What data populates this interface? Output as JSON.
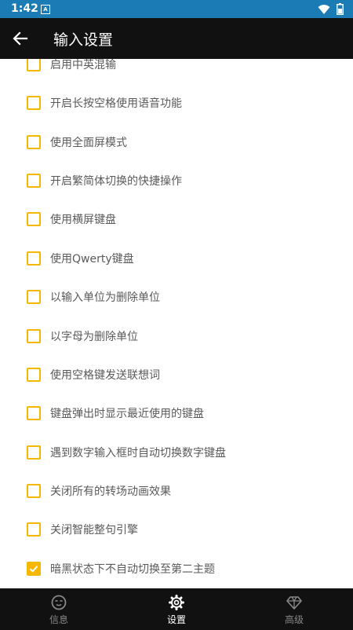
{
  "status_bar": {
    "time": "1:42",
    "app_icon": "A",
    "icons": [
      "wifi-icon",
      "battery-icon"
    ]
  },
  "header": {
    "title": "输入设置",
    "back_icon": "arrow-back-icon"
  },
  "settings": [
    {
      "label": "启用中英混输",
      "checked": false
    },
    {
      "label": "开启长按空格使用语音功能",
      "checked": false
    },
    {
      "label": "使用全面屏模式",
      "checked": false
    },
    {
      "label": "开启繁简体切换的快捷操作",
      "checked": false
    },
    {
      "label": "使用横屏键盘",
      "checked": false
    },
    {
      "label": "使用Qwerty键盘",
      "checked": false
    },
    {
      "label": "以输入单位为删除单位",
      "checked": false
    },
    {
      "label": "以字母为删除单位",
      "checked": false
    },
    {
      "label": "使用空格键发送联想词",
      "checked": false
    },
    {
      "label": "键盘弹出时显示最近使用的键盘",
      "checked": false
    },
    {
      "label": "遇到数字输入框时自动切换数字键盘",
      "checked": false
    },
    {
      "label": "关闭所有的转场动画效果",
      "checked": false
    },
    {
      "label": "关闭智能整句引擎",
      "checked": false
    },
    {
      "label": "暗黑状态下不自动切换至第二主题",
      "checked": true
    }
  ],
  "bottom_nav": {
    "items": [
      {
        "label": "信息",
        "icon": "face-icon",
        "active": false
      },
      {
        "label": "设置",
        "icon": "gear-icon",
        "active": true
      },
      {
        "label": "高级",
        "icon": "diamond-icon",
        "active": false
      }
    ]
  },
  "colors": {
    "status_bar": "#1a7bb5",
    "app_bar": "#111111",
    "checkbox_accent": "#f5b800",
    "label_text": "#5a5a5a"
  }
}
